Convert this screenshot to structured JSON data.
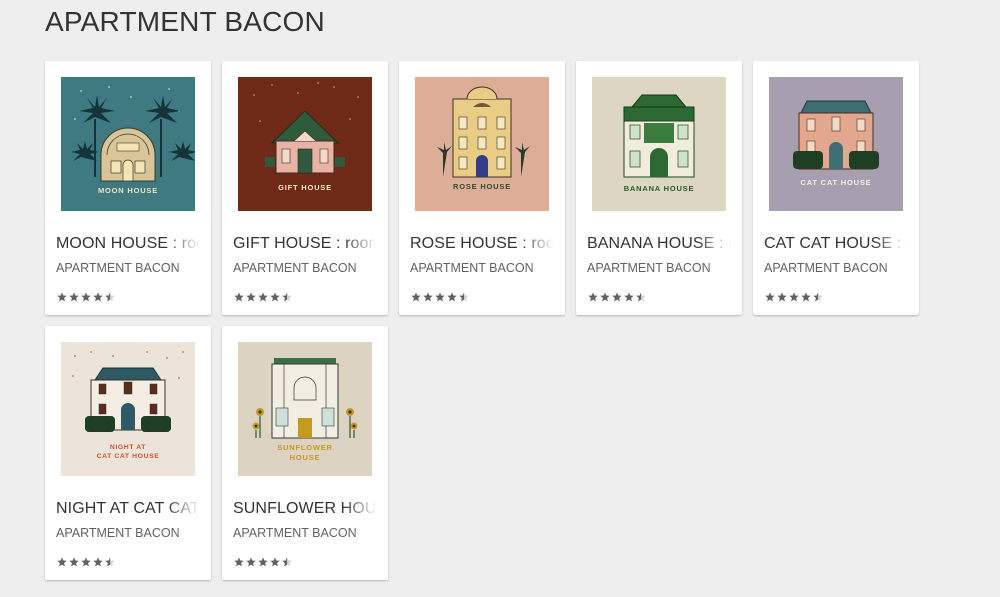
{
  "page": {
    "title": "APARTMENT BACON"
  },
  "colors": {
    "background": "#eeeeee",
    "card": "#ffffff",
    "star": "#616161",
    "star_empty": "#d0d0d0"
  },
  "cards": [
    {
      "title": "MOON HOUSE : room",
      "author": "APARTMENT BACON",
      "cover_label": "MOON HOUSE",
      "cover_bg": "#3f7a80",
      "cover_label_color": "#f1e3c2",
      "rating": 4.5,
      "icon": "moon-house-cover-image"
    },
    {
      "title": "GIFT HOUSE : room",
      "author": "APARTMENT BACON",
      "cover_label": "GIFT HOUSE",
      "cover_bg": "#6e2a16",
      "cover_label_color": "#f4e6cf",
      "rating": 4.5,
      "icon": "gift-house-cover-image"
    },
    {
      "title": "ROSE HOUSE : room",
      "author": "APARTMENT BACON",
      "cover_label": "ROSE HOUSE",
      "cover_bg": "#dcae98",
      "cover_label_color": "#2f4c2e",
      "rating": 4.5,
      "icon": "rose-house-cover-image"
    },
    {
      "title": "BANANA HOUSE : room",
      "author": "APARTMENT BACON",
      "cover_label": "BANANA HOUSE",
      "cover_bg": "#dcd6c2",
      "cover_label_color": "#2d5a2a",
      "rating": 4.5,
      "icon": "banana-house-cover-image"
    },
    {
      "title": "CAT CAT HOUSE : room",
      "author": "APARTMENT BACON",
      "cover_label": "CAT CAT HOUSE",
      "cover_bg": "#a79fb0",
      "cover_label_color": "#f6eee2",
      "rating": 4.5,
      "icon": "cat-cat-house-cover-image"
    },
    {
      "title": "NIGHT AT CAT CAT HOUSE",
      "author": "APARTMENT BACON",
      "cover_label": "NIGHT AT",
      "cover_label_2": "CAT CAT HOUSE",
      "cover_bg": "#ece3da",
      "cover_label_color": "#c9542e",
      "rating": 4.5,
      "icon": "night-at-cat-cat-house-cover-image"
    },
    {
      "title": "SUNFLOWER HOUSE",
      "author": "APARTMENT BACON",
      "cover_label": "SUNFLOWER",
      "cover_label_2": "HOUSE",
      "cover_bg": "#dcd3c3",
      "cover_label_color": "#c39b1d",
      "rating": 4.5,
      "icon": "sunflower-house-cover-image"
    }
  ]
}
